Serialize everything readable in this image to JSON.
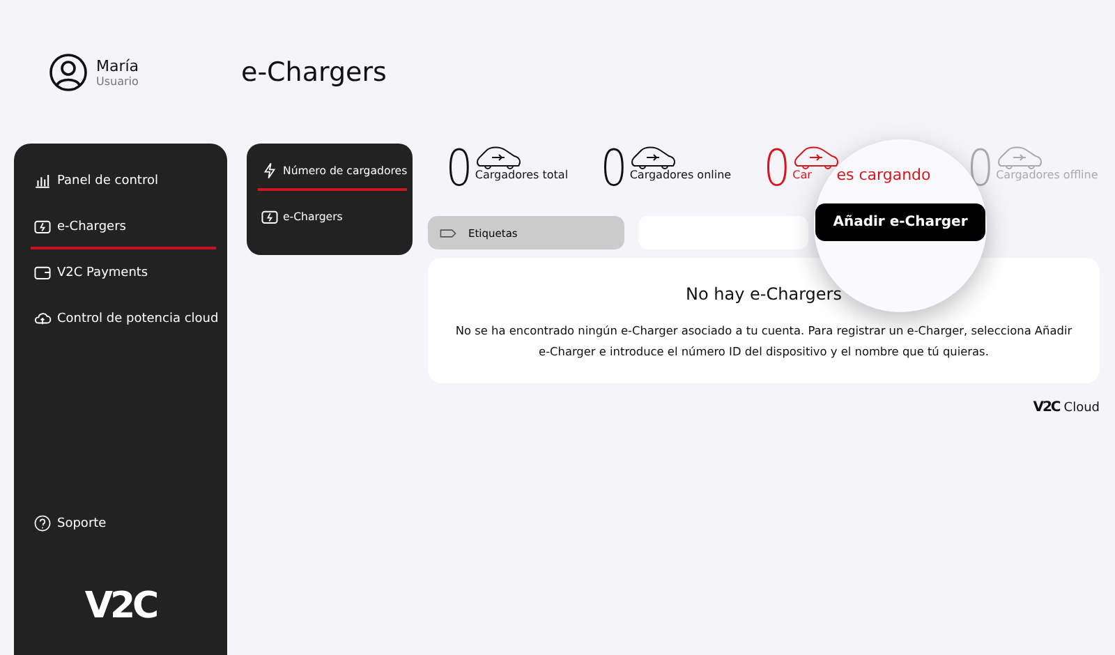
{
  "user": {
    "name": "María",
    "role": "Usuario"
  },
  "page_title": "e-Chargers",
  "sidebar": {
    "items": [
      {
        "label": "Panel de control",
        "selected": false
      },
      {
        "label": "e-Chargers",
        "selected": true
      },
      {
        "label": "V2C Payments",
        "selected": false
      },
      {
        "label": "Control de potencia cloud",
        "selected": false
      }
    ],
    "support": "Soporte",
    "logo": "V2C"
  },
  "submenu": [
    {
      "label": "Número de cargadores",
      "selected": true
    },
    {
      "label": "e-Chargers",
      "selected": false
    }
  ],
  "stats": [
    {
      "value": "0",
      "label": "Cargadores total",
      "kind": "normal"
    },
    {
      "value": "0",
      "label": "Cargadores online",
      "kind": "normal"
    },
    {
      "value": "0",
      "label": "Car",
      "kind": "charging"
    },
    {
      "value": "0",
      "label": "Cargadores offline",
      "kind": "offline"
    }
  ],
  "tags_filter": {
    "label": "Etiquetas"
  },
  "magnifier": {
    "text": "es cargando",
    "button": "Añadir e-Charger"
  },
  "empty_state": {
    "title": "No hay e-Chargers",
    "message": "No se ha encontrado ningún e-Charger asociado a tu cuenta. Para registrar un e-Charger, selecciona Añadir e-Charger e introduce el número ID del dispositivo y el nombre que tú quieras."
  },
  "footer": {
    "brand": "V2C",
    "suffix": "Cloud"
  }
}
